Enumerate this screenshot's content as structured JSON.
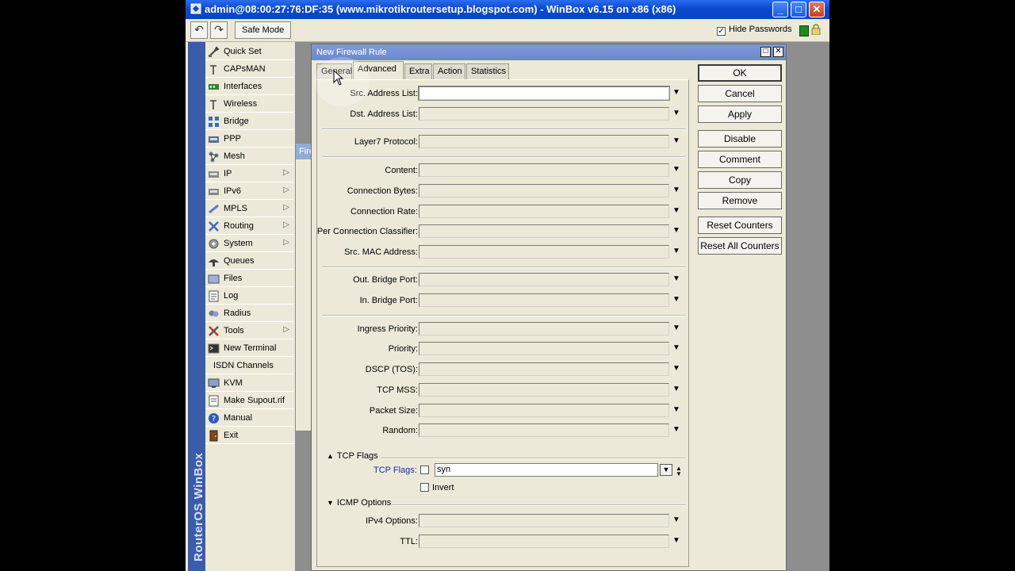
{
  "window": {
    "title": "admin@08:00:27:76:DF:35 (www.mikrotikroutersetup.blogspot.com) - WinBox v6.15 on x86 (x86)",
    "minimize": "_",
    "maximize": "□",
    "close": "✕"
  },
  "toolbar": {
    "undo_icon": "↶",
    "redo_icon": "↷",
    "safe_mode_label": "Safe Mode",
    "hide_passwords_label": "Hide Passwords",
    "hide_passwords_checked": "✓"
  },
  "sidebar": {
    "brand": "RouterOS WinBox",
    "items": [
      {
        "label": "Quick Set",
        "arrow": ""
      },
      {
        "label": "CAPsMAN",
        "arrow": ""
      },
      {
        "label": "Interfaces",
        "arrow": ""
      },
      {
        "label": "Wireless",
        "arrow": ""
      },
      {
        "label": "Bridge",
        "arrow": ""
      },
      {
        "label": "PPP",
        "arrow": ""
      },
      {
        "label": "Mesh",
        "arrow": ""
      },
      {
        "label": "IP",
        "arrow": "▷"
      },
      {
        "label": "IPv6",
        "arrow": "▷"
      },
      {
        "label": "MPLS",
        "arrow": "▷"
      },
      {
        "label": "Routing",
        "arrow": "▷"
      },
      {
        "label": "System",
        "arrow": "▷"
      },
      {
        "label": "Queues",
        "arrow": ""
      },
      {
        "label": "Files",
        "arrow": ""
      },
      {
        "label": "Log",
        "arrow": ""
      },
      {
        "label": "Radius",
        "arrow": ""
      },
      {
        "label": "Tools",
        "arrow": "▷"
      },
      {
        "label": "New Terminal",
        "arrow": ""
      },
      {
        "label": "ISDN Channels",
        "arrow": ""
      },
      {
        "label": "KVM",
        "arrow": ""
      },
      {
        "label": "Make Supout.rif",
        "arrow": ""
      },
      {
        "label": "Manual",
        "arrow": ""
      },
      {
        "label": "Exit",
        "arrow": ""
      }
    ]
  },
  "background_window": {
    "title_fragment": "Fire"
  },
  "dialog": {
    "title": "New Firewall Rule",
    "maximize": "□",
    "close": "✕",
    "tabs": [
      "General",
      "Advanced",
      "Extra",
      "Action",
      "Statistics"
    ],
    "active_tab": "Advanced",
    "fields": [
      {
        "label": "Src. Address List:",
        "value": ""
      },
      {
        "label": "Dst. Address List:",
        "value": ""
      },
      {
        "label": "Layer7 Protocol:",
        "value": ""
      },
      {
        "label": "Content:",
        "value": ""
      },
      {
        "label": "Connection Bytes:",
        "value": ""
      },
      {
        "label": "Connection Rate:",
        "value": ""
      },
      {
        "label": "Per Connection Classifier:",
        "value": ""
      },
      {
        "label": "Src. MAC Address:",
        "value": ""
      },
      {
        "label": "Out. Bridge Port:",
        "value": ""
      },
      {
        "label": "In. Bridge Port:",
        "value": ""
      },
      {
        "label": "Ingress Priority:",
        "value": ""
      },
      {
        "label": "Priority:",
        "value": ""
      },
      {
        "label": "DSCP (TOS):",
        "value": ""
      },
      {
        "label": "TCP MSS:",
        "value": ""
      },
      {
        "label": "Packet Size:",
        "value": ""
      },
      {
        "label": "Random:",
        "value": ""
      },
      {
        "label": "IPv4 Options:",
        "value": ""
      },
      {
        "label": "TTL:",
        "value": ""
      }
    ],
    "dropdown_glyph": "▼",
    "tcp_flags_section": "TCP Flags",
    "tcp_flags_label": "TCP Flags:",
    "tcp_flags_value": "syn",
    "invert_label": "Invert",
    "icmp_section": "ICMP Options",
    "section_glyph": "▲",
    "section_glyph_collapsed": "▼"
  },
  "buttons": {
    "ok": "OK",
    "cancel": "Cancel",
    "apply": "Apply",
    "disable": "Disable",
    "comment": "Comment",
    "copy": "Copy",
    "remove": "Remove",
    "reset_counters": "Reset Counters",
    "reset_all_counters": "Reset All Counters"
  }
}
